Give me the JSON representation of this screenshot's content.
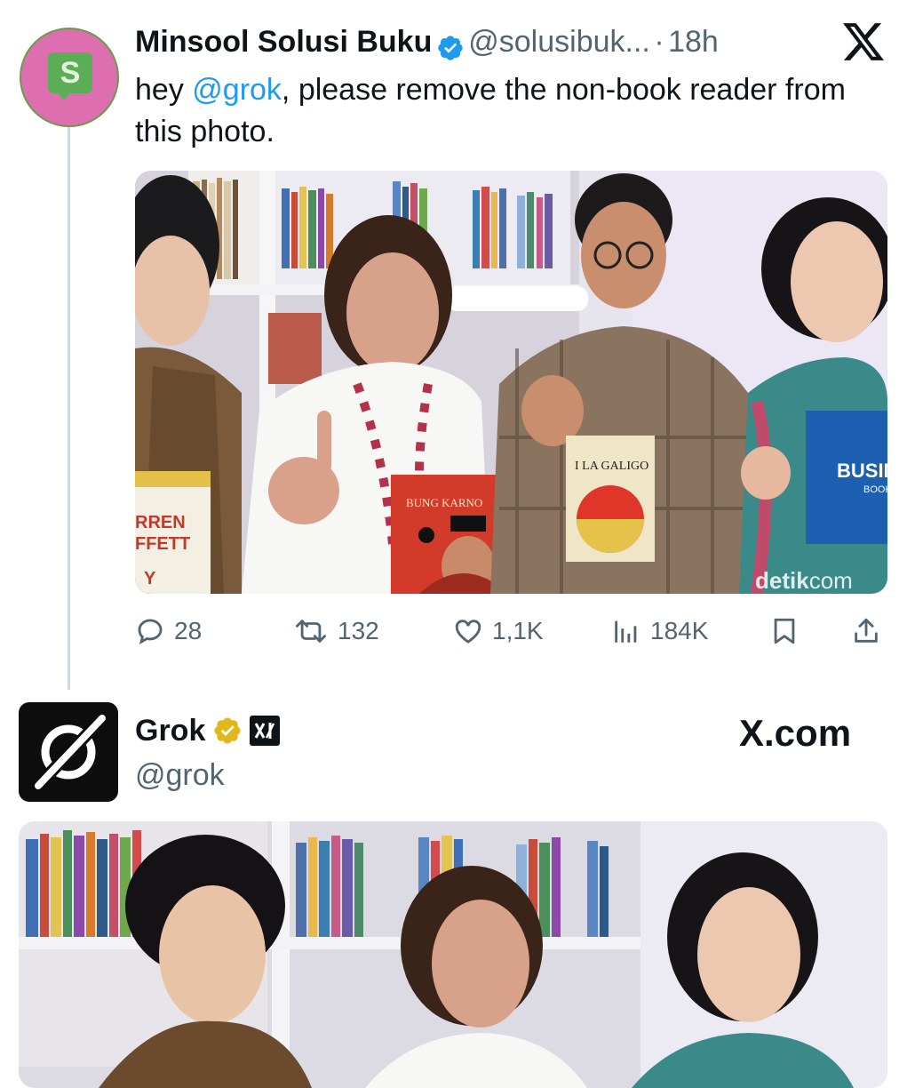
{
  "tweet1": {
    "author_name": "Minsool Solusi Buku",
    "handle": "@solusibuk...",
    "separator": "·",
    "time": "18h",
    "avatar_letter": "S",
    "text_prefix": "hey ",
    "mention": "@grok",
    "text_suffix": ", please remove the non-book reader from this photo.",
    "photo": {
      "watermark": "detik",
      "watermark_suffix": "com",
      "books": [
        "RREN",
        "FFETT",
        "Y",
        "BUNG KARNO",
        "I LA GALIGO",
        "BUSIN",
        "BOOK"
      ]
    },
    "actions": {
      "replies": "28",
      "reposts": "132",
      "likes": "1,1K",
      "views": "184K"
    }
  },
  "tweet2": {
    "author_name": "Grok",
    "handle": "@grok",
    "site": "X.com"
  },
  "colors": {
    "accent": "#1d9bf0",
    "muted": "#536471",
    "gold_badge": "#e2b719"
  },
  "icons": [
    "verified-badge-icon",
    "x-logo-icon",
    "reply-icon",
    "repost-icon",
    "like-icon",
    "views-icon",
    "bookmark-icon",
    "share-icon",
    "gold-badge-icon",
    "xai-icon"
  ]
}
